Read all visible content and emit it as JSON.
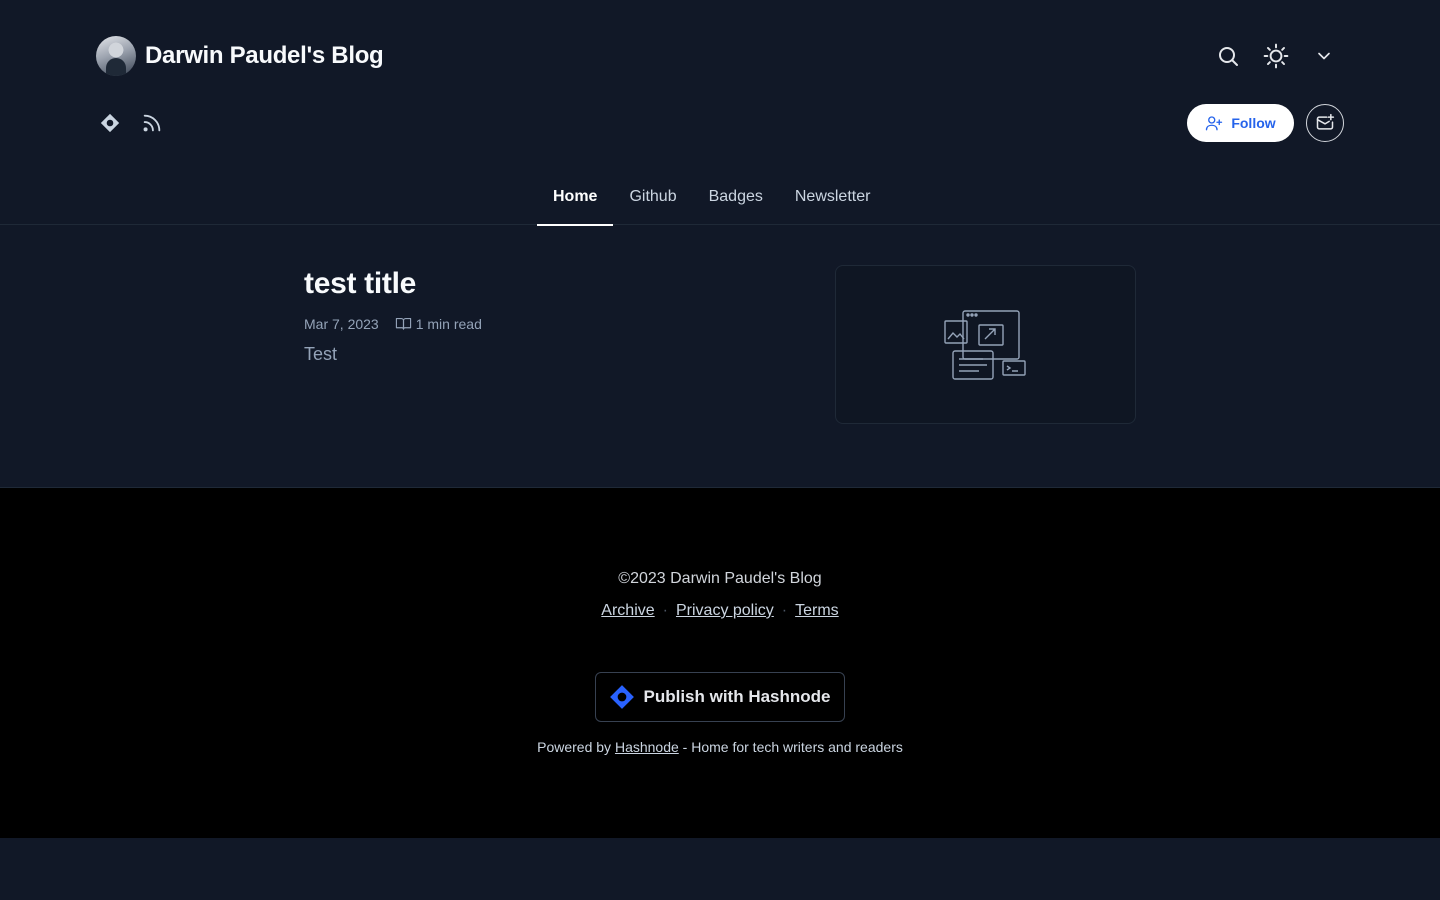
{
  "header": {
    "blog_title": "Darwin Paudel's Blog",
    "icons": [
      "search-icon",
      "sun-icon",
      "chevron-down-icon"
    ],
    "social_icons": [
      "hashnode-icon",
      "rss-icon"
    ],
    "follow_label": "Follow",
    "newsletter_icon": "newsletter-icon"
  },
  "nav": {
    "items": [
      {
        "label": "Home",
        "active": true
      },
      {
        "label": "Github",
        "active": false
      },
      {
        "label": "Badges",
        "active": false
      },
      {
        "label": "Newsletter",
        "active": false
      }
    ]
  },
  "post": {
    "title": "test title",
    "date": "Mar 7, 2023",
    "read_time": "1 min read",
    "excerpt": "Test"
  },
  "footer": {
    "copyright": "©2023 Darwin Paudel's Blog",
    "links": [
      "Archive",
      "Privacy policy",
      "Terms"
    ],
    "separator": "·",
    "publish_label": "Publish with Hashnode",
    "powered_prefix": "Powered by",
    "powered_link": "Hashnode",
    "powered_suffix": "- Home for tech writers and readers"
  },
  "colors": {
    "background": "#111827",
    "footer_bg": "#000000",
    "accent": "#2563eb"
  }
}
